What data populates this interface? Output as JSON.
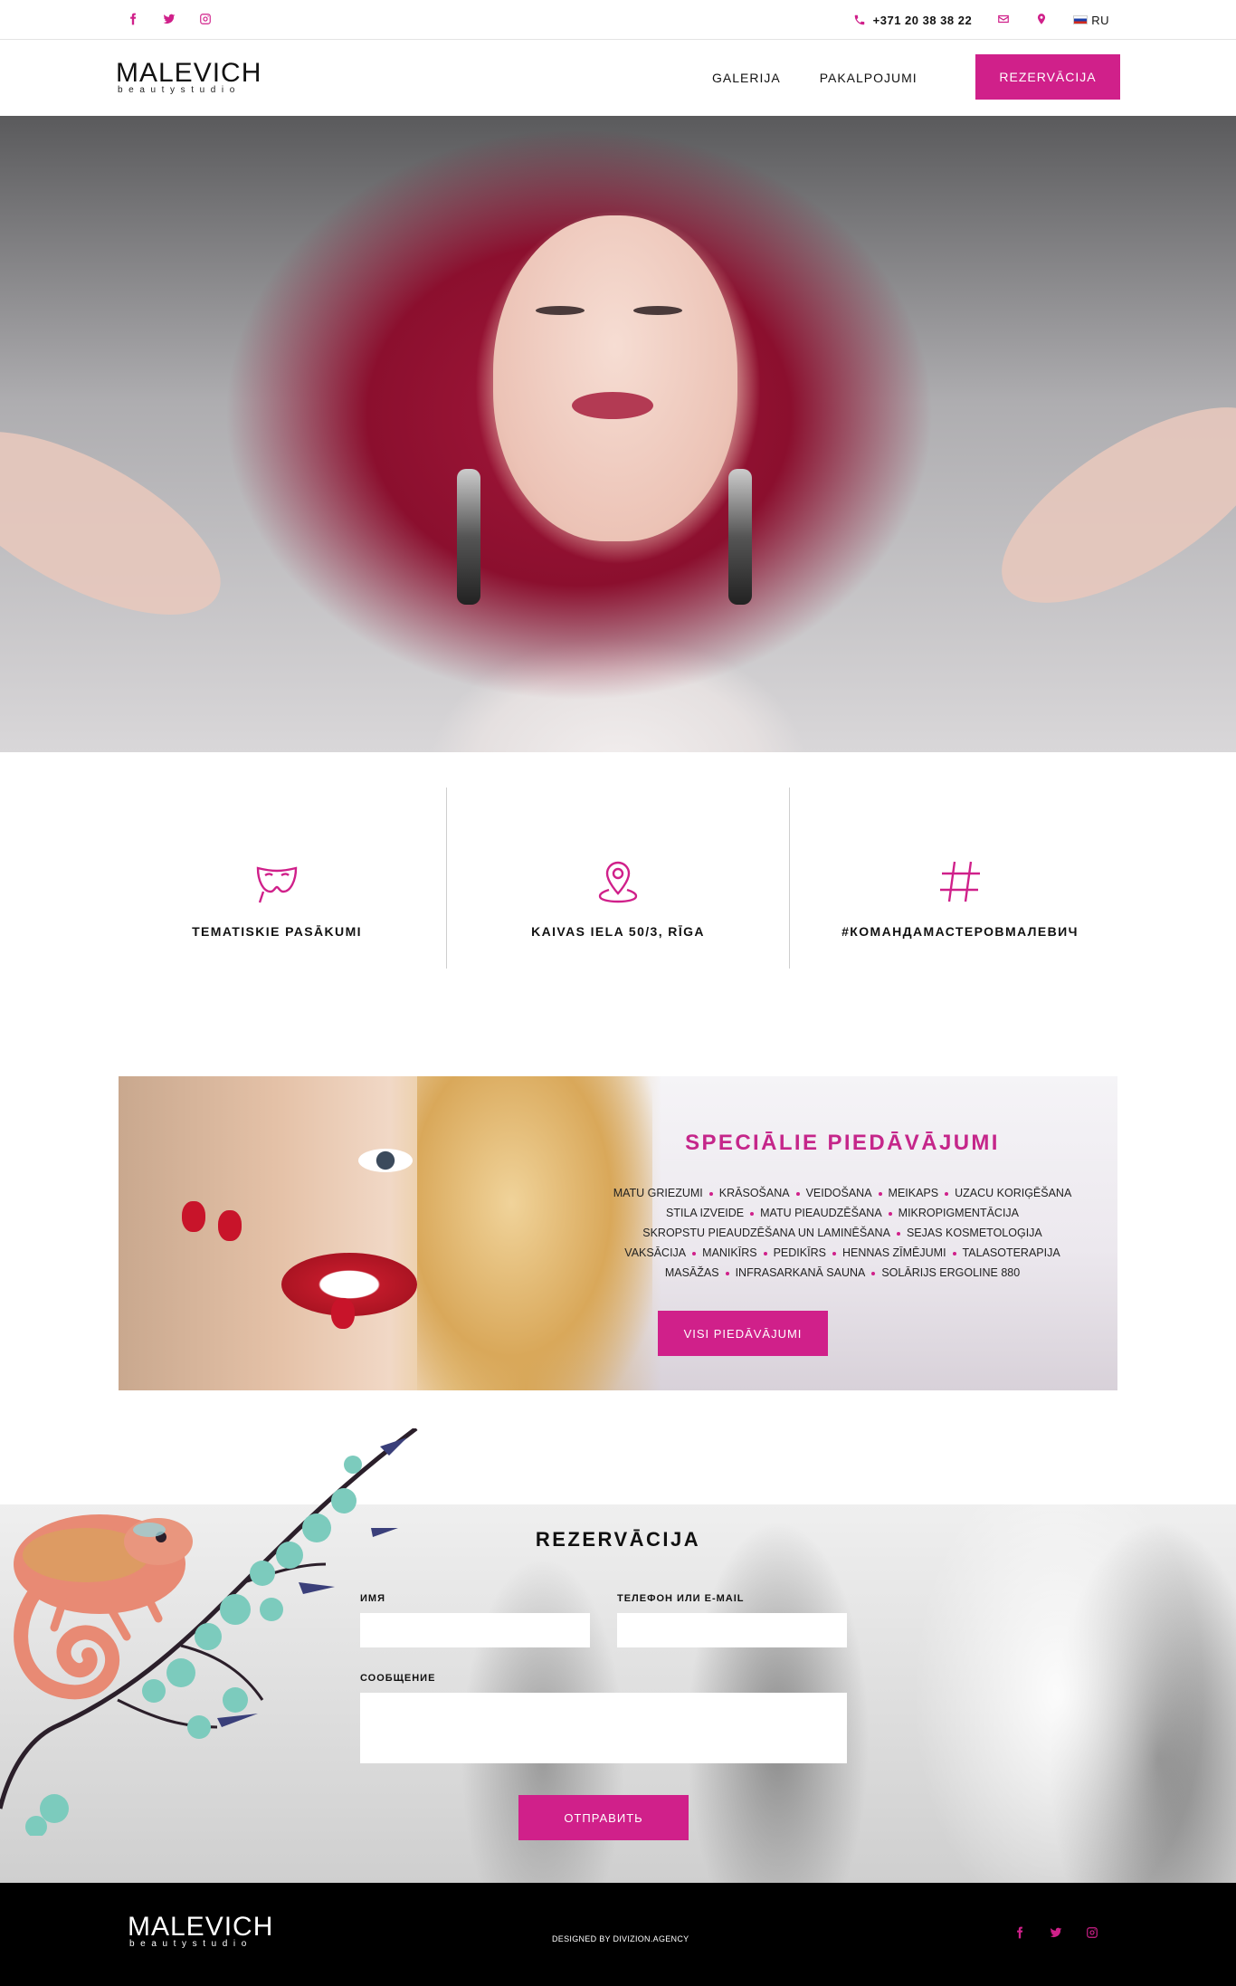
{
  "colors": {
    "accent": "#d0208a",
    "footer_bg": "#000000"
  },
  "topbar": {
    "social": [
      "facebook-icon",
      "twitter-icon",
      "instagram-icon"
    ],
    "phone": "+371 20 38 38 22",
    "language": "RU"
  },
  "header": {
    "logo_name": "MALEVICH",
    "logo_tagline": "beautystudio",
    "nav": [
      "GALERIJA",
      "PAKALPOJUMI"
    ],
    "cta": "REZERVĀCIJA"
  },
  "features": [
    {
      "icon": "mask-icon",
      "label": "TEMATISKIE PASĀKUMI"
    },
    {
      "icon": "map-pin-icon",
      "label": "KAIVAS IELA 50/3, RĪGA"
    },
    {
      "icon": "hashtag-icon",
      "label": "#КОМАНДАМАСТЕРОВМАЛЕВИЧ"
    }
  ],
  "offers": {
    "title": "SPECIĀLIE PIEDĀVĀJUMI",
    "items": [
      "MATU GRIEZUMI",
      "KRĀSOŠANA",
      "VEIDOŠANA",
      "MEIKAPS",
      "UZACU KORIĢĒŠANA",
      "STILA IZVEIDE",
      "MATU PIEAUDZĒŠANA",
      "MIKROPIGMENTĀCIJA",
      "SKROPSTU PIEAUDZĒŠANA UN LAMINĒŠANA",
      "SEJAS KOSMETOLOĢIJA",
      "VAKSĀCIJA",
      "MANIKĪRS",
      "PEDIKĪRS",
      "HENNAS ZĪMĒJUMI",
      "TALASOTERAPIJA",
      "MASĀŽAS",
      "INFRASARKANĀ SAUNA",
      "SOLĀRIJS ERGOLINE 880"
    ],
    "button": "VISI PIEDĀVĀJUMI"
  },
  "reservation": {
    "title": "REZERVĀCIJA",
    "name_label": "ИМЯ",
    "contact_label": "ТЕЛЕФОН ИЛИ E-MAIL",
    "message_label": "СООБЩЕНИЕ",
    "name_value": "",
    "contact_value": "",
    "message_value": "",
    "submit": "ОТПРАВИТЬ"
  },
  "footer": {
    "logo_name": "MALEVICH",
    "logo_tagline": "beautystudio",
    "credit": "DESIGNED BY DIVIZION.AGENCY",
    "social": [
      "facebook-icon",
      "twitter-icon",
      "instagram-icon"
    ]
  }
}
